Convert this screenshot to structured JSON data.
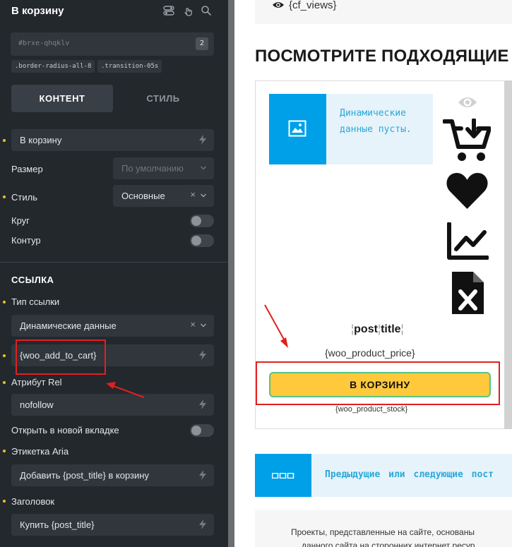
{
  "panel": {
    "title": "В корзину",
    "element_id": "#brxe-qhqklv",
    "element_id_count": "2",
    "classes": [
      ".border-radius-all-8",
      ".transition-05s"
    ],
    "tabs": [
      {
        "label": "КОНТЕНТ",
        "active": true
      },
      {
        "label": "СТИЛЬ",
        "active": false
      }
    ],
    "text_field": "В корзину",
    "size": {
      "label": "Размер",
      "value": "По умолчанию"
    },
    "style": {
      "label": "Стиль",
      "value": "Основные"
    },
    "circle": {
      "label": "Круг"
    },
    "outline": {
      "label": "Контур"
    },
    "link_section": {
      "title": "ССЫЛКА",
      "link_type_label": "Тип ссылки",
      "link_type_value": "Динамические данные",
      "dynamic_tag": "{woo_add_to_cart}",
      "rel_label": "Атрибут Rel",
      "rel_value": "nofollow",
      "new_tab_label": "Открыть в новой вкладке",
      "aria_label": "Этикетка Aria",
      "aria_value": "Добавить {post_title} в корзину",
      "title_label": "Заголовок",
      "title_value": "Купить {post_title}"
    },
    "accent_color": "#f2c31c"
  },
  "canvas": {
    "cf_views": "{cf_views}",
    "heading": "ПОСМОТРИТЕ ПОДХОДЯЩИЕ Т",
    "dynamic_empty": "Динамические данные пусты.",
    "post_title": "post title",
    "post_title_parts": [
      "post",
      "title"
    ],
    "price": "{woo_product_price}",
    "cart_button": "В КОРЗИНУ",
    "stock": "{woo_product_stock}",
    "nav_text": "Предыдущие или следующие пост",
    "footer_line1": "Проекты, представленные на сайте, основаны",
    "footer_line2": "данного сайта на сторонних интернет ресур",
    "icons": [
      "eye-icon",
      "cart-download-icon",
      "heart-icon",
      "chart-line-icon",
      "excel-file-icon"
    ],
    "brand_color": "#00a0e9",
    "button_color": "#ffc93b"
  },
  "annotation_color": "#e02020"
}
